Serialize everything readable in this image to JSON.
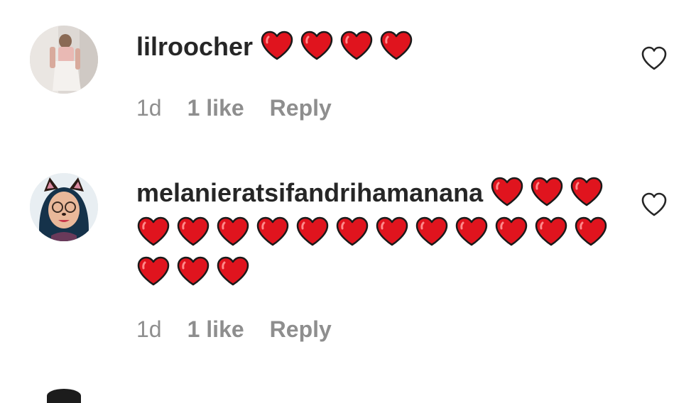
{
  "comments": [
    {
      "username": "lilroocher",
      "heart_count": 4,
      "time": "1d",
      "likes": "1 like",
      "reply_label": "Reply",
      "avatar_icon": "avatar-photo"
    },
    {
      "username": "melanieratsifandrihamanana",
      "heart_count": 18,
      "time": "1d",
      "likes": "1 like",
      "reply_label": "Reply",
      "avatar_icon": "avatar-photo-cat-filter"
    }
  ],
  "icons": {
    "heart_emoji": "red-heart-emoji",
    "like": "heart-outline-icon"
  },
  "colors": {
    "heart_fill": "#e0141e",
    "heart_stroke": "#1a1a1a",
    "text_primary": "#262626",
    "text_secondary": "#8e8e8e"
  }
}
